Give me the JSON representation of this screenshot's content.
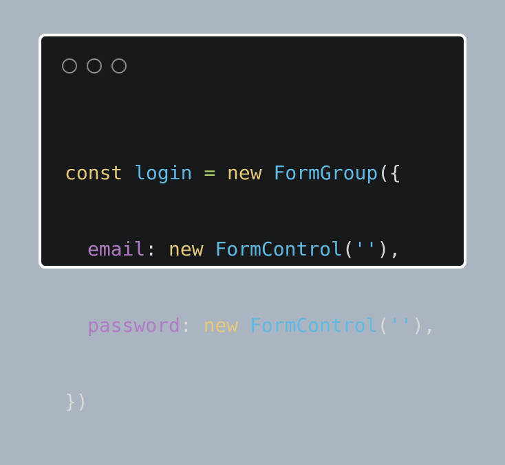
{
  "window": {
    "controls": [
      "circle-icon",
      "circle-icon",
      "circle-icon"
    ]
  },
  "code": {
    "line1": {
      "kw_const": "const",
      "var_name": "login",
      "op_eq": "=",
      "kw_new": "new",
      "class_name": "FormGroup",
      "open": "({"
    },
    "line2": {
      "prop": "email",
      "colon": ":",
      "kw_new": "new",
      "class_name": "FormControl",
      "paren_open": "(",
      "string": "''",
      "paren_close": "),"
    },
    "line3": {
      "prop": "password",
      "colon": ":",
      "kw_new": "new",
      "class_name": "FormControl",
      "paren_open": "(",
      "string": "''",
      "paren_close": "),"
    },
    "line4": {
      "close": "})"
    }
  },
  "colors": {
    "background": "#aab5c1",
    "window_bg": "#18191b",
    "keyword": "#e5c77a",
    "identifier": "#5fb9e2",
    "property": "#b17bc6",
    "operator": "#a6cf6a",
    "punctuation": "#d8d8d8"
  }
}
